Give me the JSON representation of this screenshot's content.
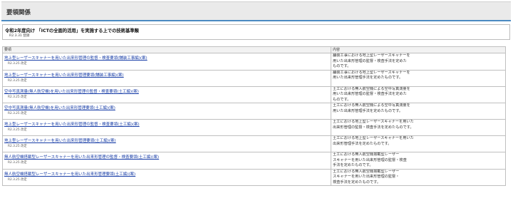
{
  "section": {
    "title": "要領関係"
  },
  "standard": {
    "title": "令和2年度向け 「ICTの全面的活用」を実施する上での技術基準類",
    "date": "R2.3.31 登録"
  },
  "table": {
    "headers": {
      "title": "要領",
      "content": "内容"
    },
    "rows": [
      {
        "title": "地上型レーザースキャナーを用いた出来形管理の監督・検査要領(舗装工事編)(案)",
        "date": "R2.3.25 改定",
        "desc": [
          "舗装工事における地上型レーザースキャナーを",
          "用いた出来形管理の監督・検査手法を定めた",
          "ものです。"
        ]
      },
      {
        "title": "地上型レーザースキャナーを用いた出来形管理要領(舗装工事編)(案)",
        "date": "R2.3.25 改定",
        "desc": [
          "舗装工事における地上型レーザースキャナーを",
          "用いた出来形管理手法を定めたものです。"
        ]
      },
      {
        "title": "空中写真測量(無人航空機)を用いた出来形管理の監督・検査要領(土工編)(案)",
        "date": "R2.3.25 改定",
        "desc": [
          "土工における無人航空機による空中写真測量を",
          "用いた出来形管理の監督・検査手法を定めた",
          "ものです。"
        ]
      },
      {
        "title": "空中写真測量(無人航空機)を用いた出来形管理要領(土工編)(案)",
        "date": "R2.3.25 改定",
        "desc": [
          "土工における無人航空機による空中写真測量を",
          "用いた出来形管理手法を定めたものです。"
        ]
      },
      {
        "title": "地上型レーザースキャナーを用いた出来形管理の監督・検査要領(土工編)(案)",
        "date": "R2.3.25 改定",
        "desc": [
          "土工における地上型レーザースキャナーを用いた",
          "出来形管理の監督・検査手法を定めたものです。"
        ]
      },
      {
        "title": "地上型レーザースキャナーを用いた出来形管理要領(土工編)(案)",
        "date": "R2.3.25 改定",
        "desc": [
          "土工における地上型レーザースキャナーを用いた",
          "出来形管理手法を定めたものです。"
        ]
      },
      {
        "title": "無人航空機搭載型レーザースキャナーを用いた出来形管理の監督・検査要領(土工編)(案)",
        "date": "R2.3.25 改定",
        "desc": [
          "土工における無人航空機搭載型レーザー",
          "スキャナーを用いた出来形管理の監督・検査",
          "手法を定めたものです。"
        ]
      },
      {
        "title": "無人航空機搭載型レーザースキャナーを用いた出来形管理要領(土工編)(案)",
        "date": "R2.3.25 改定",
        "desc": [
          "土工における無人航空機搭載型レーザー",
          "スキャナーを用いた出来形管理の監督・",
          "検査手法を定めたものです。"
        ]
      }
    ]
  }
}
